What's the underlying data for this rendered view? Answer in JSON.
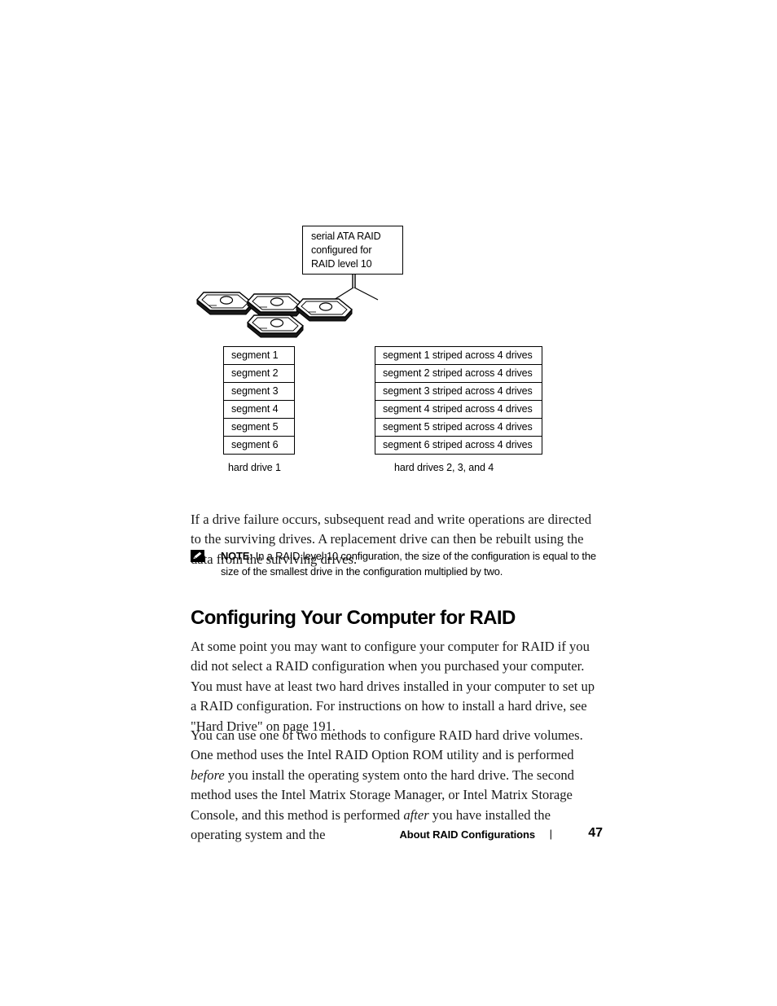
{
  "figure": {
    "callout": {
      "name": "serial-ata-raid-callout",
      "text": "serial ATA RAID\nconfigured for\nRAID level 10"
    },
    "drive_count": 4,
    "left_table": {
      "rows": [
        "segment 1",
        "segment 2",
        "segment 3",
        "segment 4",
        "segment 5",
        "segment 6"
      ],
      "caption": "hard drive 1"
    },
    "right_table": {
      "rows": [
        "segment 1 striped across 4 drives",
        "segment 2 striped across 4 drives",
        "segment 3 striped across 4 drives",
        "segment 4 striped across 4 drives",
        "segment 5 striped across 4 drives",
        "segment 6 striped across 4 drives"
      ],
      "caption": "hard drives 2, 3, and 4"
    }
  },
  "body": {
    "para_failure": "If a drive failure occurs, subsequent read and write operations are directed to the surviving drives. A replacement drive can then be rebuilt using the data from the surviving drives.",
    "para_configure": "At some point you may want to configure your computer for RAID if you did not select a RAID configuration when you purchased your computer. You must have at least two hard drives installed in your computer to set up a RAID configuration. For instructions on how to install a hard drive, see \"Hard Drive\" on page 191."
  },
  "methods_paragraph": {
    "part1": "You can use one of two methods to configure RAID hard drive volumes. One method uses the Intel RAID Option ROM utility and is performed ",
    "emphasis1": "before",
    "part2": " you install the operating system onto the hard drive. The second method uses the Intel Matrix Storage Manager, or Intel Matrix Storage Console, and this method is performed ",
    "emphasis2": "after",
    "part3": " you have installed the operating system and the"
  },
  "note": {
    "icon": "note-pencil-icon",
    "label": "NOTE:",
    "text": " In a RAID level 10 configuration, the size of the configuration is equal to the size of the smallest drive in the configuration multiplied by two."
  },
  "heading": {
    "text": "Configuring Your Computer for RAID"
  },
  "footer": {
    "title": "About RAID Configurations",
    "separator": "|",
    "page_number": "47"
  },
  "colors": {
    "text": "#1a1a1a",
    "rule": "#000000",
    "background": "#ffffff"
  }
}
